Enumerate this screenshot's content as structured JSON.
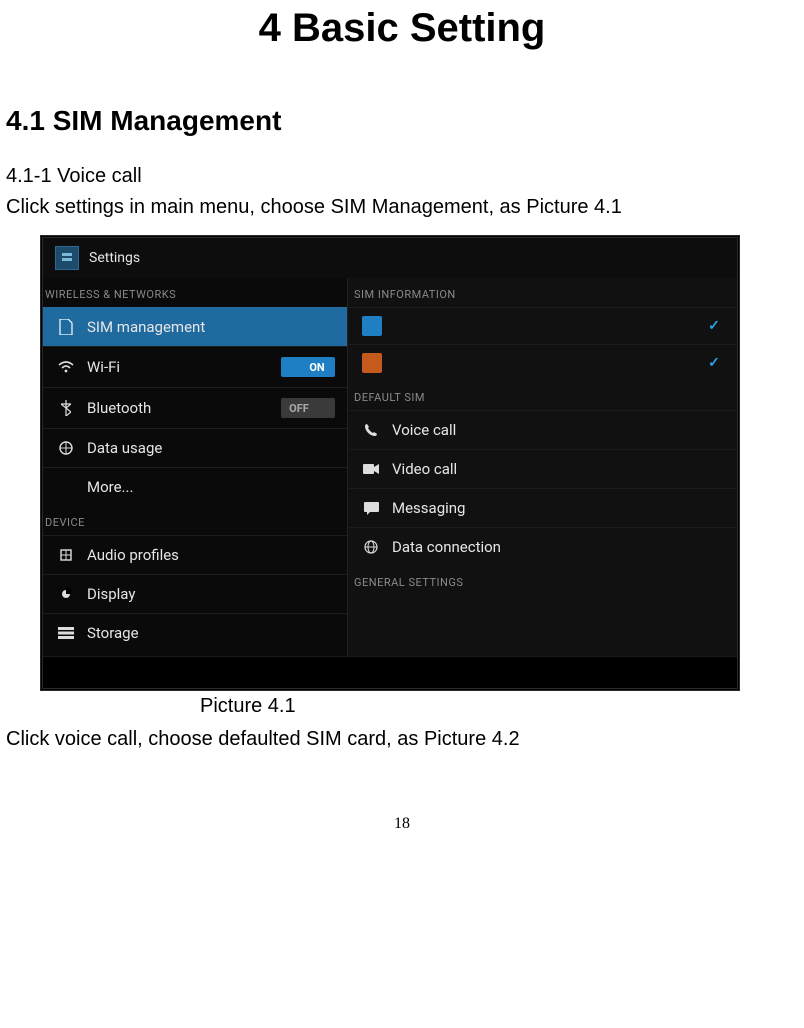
{
  "doc": {
    "chapter_title": "4 Basic Setting",
    "section_title": "4.1 SIM Management",
    "subsection": "4.1-1 Voice call",
    "intro_line": "Click settings in main menu, choose SIM Management, as Picture 4.1",
    "caption": "Picture 4.1",
    "after_caption": "Click voice call, choose defaulted SIM card, as Picture 4.2",
    "page_number": "18"
  },
  "screenshot": {
    "header_title": "Settings",
    "left": {
      "section1": "WIRELESS & NETWORKS",
      "items1": [
        {
          "label": "SIM management",
          "icon": "sim-icon",
          "selected": true
        },
        {
          "label": "Wi-Fi",
          "icon": "wifi-icon",
          "toggle": "ON"
        },
        {
          "label": "Bluetooth",
          "icon": "bluetooth-icon",
          "toggle": "OFF"
        },
        {
          "label": "Data usage",
          "icon": "data-icon"
        },
        {
          "label": "More...",
          "icon": ""
        }
      ],
      "section2": "DEVICE",
      "items2": [
        {
          "label": "Audio profiles",
          "icon": "audio-icon"
        },
        {
          "label": "Display",
          "icon": "display-icon"
        },
        {
          "label": "Storage",
          "icon": "storage-icon"
        }
      ]
    },
    "right": {
      "section_info": "SIM INFORMATION",
      "sim_slots": [
        {
          "color": "blue",
          "checked": true
        },
        {
          "color": "orange",
          "checked": true
        }
      ],
      "section_default": "DEFAULT SIM",
      "default_items": [
        {
          "label": "Voice call",
          "icon": "phone-icon"
        },
        {
          "label": "Video call",
          "icon": "video-icon"
        },
        {
          "label": "Messaging",
          "icon": "message-icon"
        },
        {
          "label": "Data connection",
          "icon": "globe-icon"
        }
      ],
      "section_general": "GENERAL SETTINGS"
    },
    "toggle_labels": {
      "on": "ON",
      "off": "OFF"
    }
  }
}
